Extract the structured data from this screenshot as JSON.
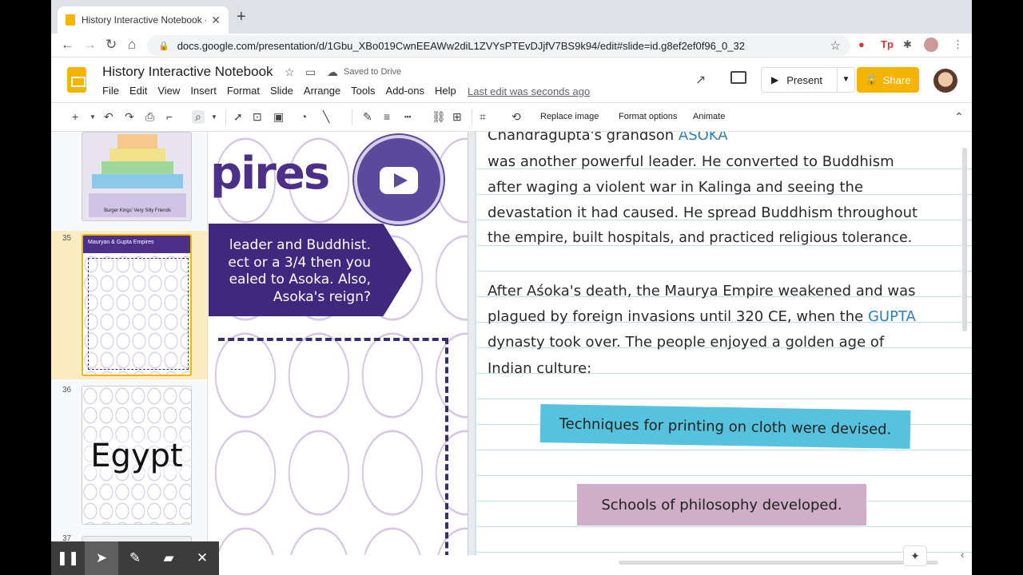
{
  "browser": {
    "tab_title": "History Interactive Notebook -",
    "url": "docs.google.com/presentation/d/1Gbu_XBo019CwnEEAWw2diL1ZVYsPTEvDJjfV7BS9k94/edit#slide=id.g8ef2ef0f96_0_32"
  },
  "app": {
    "doc_title": "History Interactive Notebook",
    "saved_status": "Saved to Drive",
    "menu": [
      "File",
      "Edit",
      "View",
      "Insert",
      "Format",
      "Slide",
      "Arrange",
      "Tools",
      "Add-ons",
      "Help"
    ],
    "last_edit": "Last edit was seconds ago",
    "present_label": "Present",
    "share_label": "Share"
  },
  "toolbar": {
    "replace_image": "Replace image",
    "format_options": "Format options",
    "animate": "Animate"
  },
  "filmstrip": {
    "slides": [
      {
        "number": "35",
        "title": "Mauryan & Gupta Empires"
      },
      {
        "number": "36",
        "title": "Egypt"
      },
      {
        "number": "37"
      }
    ],
    "top_thumb_caption": "Burger Kings' Very Silly Friends"
  },
  "slide": {
    "title_fragment": "pires",
    "banner_lines": [
      "leader and Buddhist.",
      "ect or a 3/4 then you",
      "ealed to Asoka. Also,",
      "Asoka's reign?"
    ],
    "para1_line0_pre": "Chandragupta's grandson ",
    "para1_line0_hl": "ASOKA",
    "para1_lines": [
      "was another powerful leader. He converted to Buddhism",
      "after waging a violent war in Kalinga and seeing the",
      "devastation it had caused. He spread Buddhism throughout",
      "the empire, built hospitals, and practiced religious tolerance."
    ],
    "para2_line1": "After Aśoka's death, the Maurya Empire weakened and was",
    "para2_line2_pre": "plagued by foreign invasions until 320 CE, when the ",
    "para2_line2_hl": "GUPTA",
    "para2_line3": "dynasty took over. The people enjoyed a golden age of",
    "para2_line4": "Indian culture:",
    "sticky1": "Techniques for printing on cloth were devised.",
    "sticky2": "Schools of philosophy developed."
  },
  "colors": {
    "accent_yellow": "#f4b400",
    "purple": "#40287e",
    "highlight_blue": "#2e7fb8",
    "sticky_blue": "#56c2dd",
    "sticky_pink": "#cfaec8"
  }
}
